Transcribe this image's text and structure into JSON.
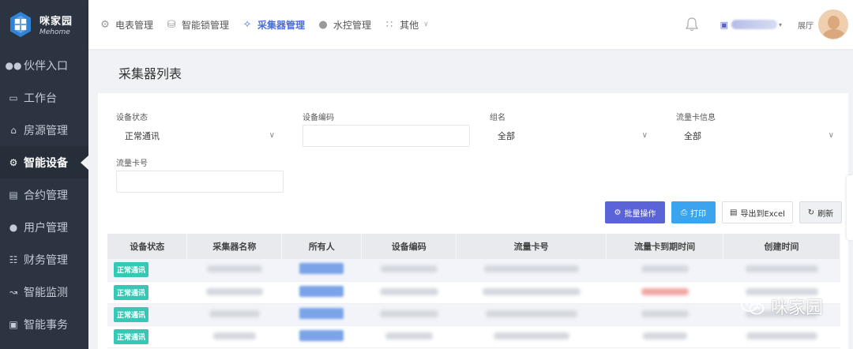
{
  "app": {
    "logo_cn": "咪家园",
    "logo_en": "Mehome"
  },
  "sidebar": {
    "items": [
      {
        "label": "伙伴入口",
        "icon": "users-icon",
        "active": false
      },
      {
        "label": "工作台",
        "icon": "monitor-icon",
        "active": false
      },
      {
        "label": "房源管理",
        "icon": "home-icon",
        "active": false
      },
      {
        "label": "智能设备",
        "icon": "gear-icon",
        "active": true
      },
      {
        "label": "合约管理",
        "icon": "document-icon",
        "active": false
      },
      {
        "label": "用户管理",
        "icon": "user-icon",
        "active": false
      },
      {
        "label": "财务管理",
        "icon": "database-icon",
        "active": false
      },
      {
        "label": "智能监测",
        "icon": "chart-line-icon",
        "active": false
      },
      {
        "label": "智能事务",
        "icon": "briefcase-icon",
        "active": false
      }
    ]
  },
  "topnav": {
    "items": [
      {
        "label": "电表管理",
        "icon": "settings-icon"
      },
      {
        "label": "智能锁管理",
        "icon": "lock-icon"
      },
      {
        "label": "采集器管理",
        "icon": "network-icon",
        "active": true
      },
      {
        "label": "水控管理",
        "icon": "water-drop-icon"
      },
      {
        "label": "其他",
        "icon": "grid-icon"
      }
    ],
    "hall_label": "展厅"
  },
  "page": {
    "title": "采集器列表"
  },
  "filters": {
    "device_status_label": "设备状态",
    "device_status_value": "正常通讯",
    "device_code_label": "设备编码",
    "group_label": "组名",
    "group_value": "全部",
    "sim_info_label": "流量卡信息",
    "sim_info_value": "全部",
    "sim_number_label": "流量卡号"
  },
  "actions": {
    "batch": "批量操作",
    "print": "打印",
    "export": "导出到Excel",
    "refresh": "刷新"
  },
  "table": {
    "columns": [
      "设备状态",
      "采集器名称",
      "所有人",
      "设备编码",
      "流量卡号",
      "流量卡到期时间",
      "创建时间"
    ],
    "rows": [
      {
        "status": "正常通讯"
      },
      {
        "status": "正常通讯"
      },
      {
        "status": "正常通讯"
      },
      {
        "status": "正常通讯"
      }
    ]
  },
  "watermark": {
    "text": "咪家园"
  },
  "colors": {
    "accent": "#4b6fd8",
    "sidebar_bg": "#2b3440",
    "badge": "#35c8b5",
    "btn_purple": "#5a63d8",
    "btn_blue": "#3ba4ee"
  }
}
